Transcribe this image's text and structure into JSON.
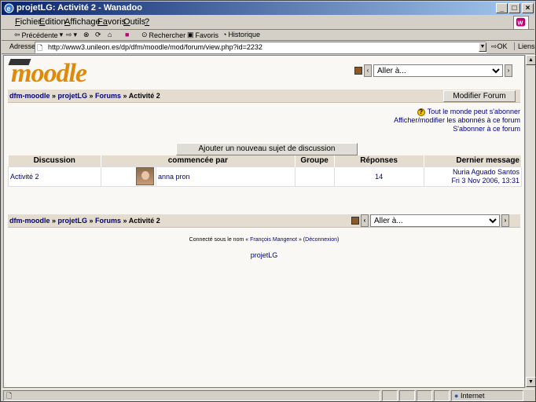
{
  "window": {
    "title": "projetLG: Activité 2 - Wanadoo",
    "min": "_",
    "max": "□",
    "close": "×"
  },
  "menu": [
    {
      "u": "F",
      "rest": "ichier"
    },
    {
      "u": "E",
      "rest": "dition"
    },
    {
      "u": "A",
      "rest": "ffichage"
    },
    {
      "u": "Fa",
      "rest": "voris"
    },
    {
      "u": "O",
      "rest": "utils"
    },
    {
      "u": "?",
      "rest": ""
    }
  ],
  "toolbar": {
    "back": "Précédente",
    "search": "Rechercher",
    "favorites": "Favoris",
    "history": "Historique"
  },
  "address": {
    "label": "Adresse",
    "url": "http://www3.unileon.es/dp/dfm/moodle/mod/forum/view.php?id=2232",
    "go": "OK",
    "links": "Liens"
  },
  "moodle": {
    "logo": "moodle",
    "jump_label": "Aller à...",
    "breadcrumb": [
      "dfm-moodle",
      "projetLG",
      "Forums",
      "Activité 2"
    ],
    "edit_forum": "Modifier Forum",
    "sublinks": [
      "Tout le monde peut s'abonner",
      "Afficher/modifier les abonnés à ce forum",
      "S'abonner à ce forum"
    ],
    "add_topic": "Ajouter un nouveau sujet de discussion",
    "table": {
      "headers": [
        "Discussion",
        "commencée par",
        "Groupe",
        "Réponses",
        "Dernier message"
      ],
      "rows": [
        {
          "discussion": "Activité 2",
          "author": "anna pron",
          "group": "",
          "replies": "14",
          "last_by": "Nuria Aguado Santos",
          "last_date": "Fri 3 Nov 2006, 13:31"
        }
      ]
    },
    "footer": {
      "prefix": "Connecté sous le nom «",
      "user": "François Mangenot",
      "mid": "» (",
      "logout": "Déconnexion",
      "suffix": ")",
      "course": "projetLG"
    }
  },
  "status": {
    "zone": "Internet"
  }
}
